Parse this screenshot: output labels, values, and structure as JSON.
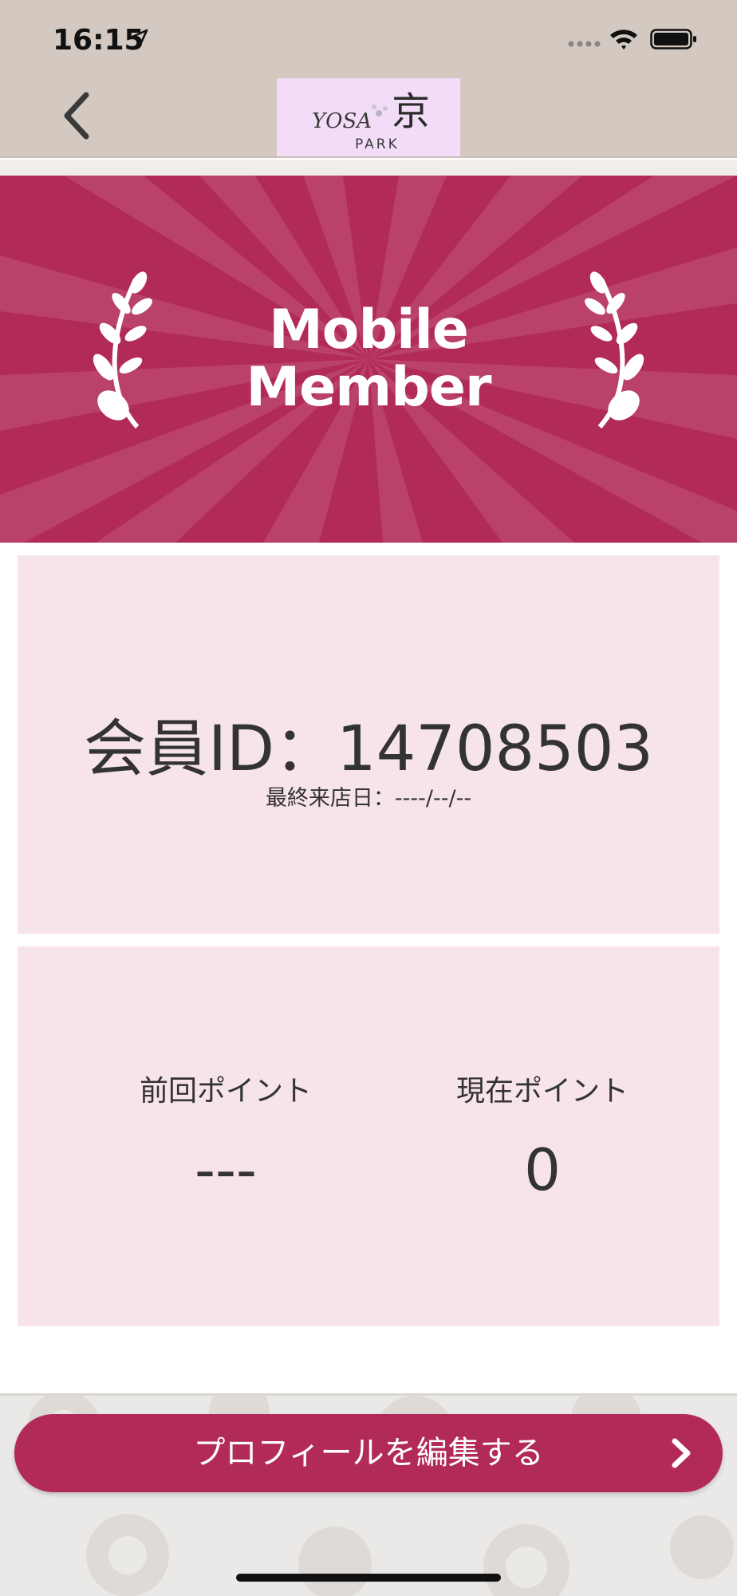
{
  "status_bar": {
    "time": "16:15",
    "icons": [
      "location-arrow-icon",
      "signal-icon",
      "wifi-icon",
      "battery-icon"
    ]
  },
  "nav_bar": {
    "back_icon": "chevron-left-icon",
    "logo_text_top": "YOSA",
    "logo_kanji": "京",
    "logo_text_bottom": "PARK",
    "logo_background": "#f3dcf7"
  },
  "banner": {
    "title_line1": "Mobile",
    "title_line2": "Member",
    "color": "#b12a59"
  },
  "member_card": {
    "member_id_text": "会員ID：14708503",
    "last_visit_text": "最終来店日：----/--/--"
  },
  "points_card": {
    "previous_label": "前回ポイント",
    "previous_value": "---",
    "current_label": "現在ポイント",
    "current_value": "0"
  },
  "edit_profile_button": {
    "label": "プロフィールを編集する",
    "icon": "chevron-right-icon"
  },
  "colors": {
    "accent": "#b12a59",
    "card_background": "#f7e4ea",
    "top_bar": "#d3c9c0"
  }
}
